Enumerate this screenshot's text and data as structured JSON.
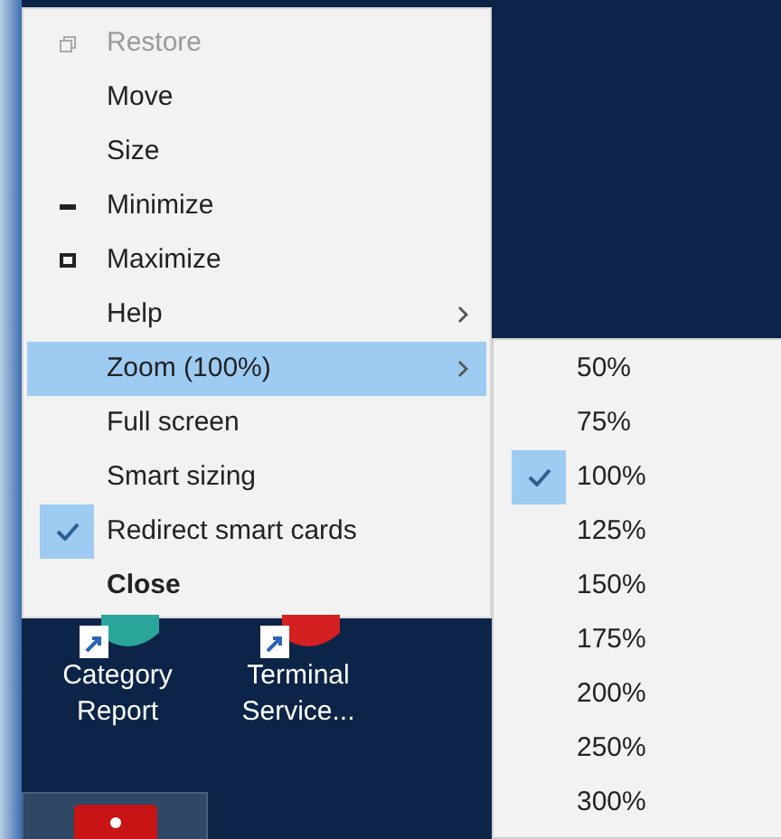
{
  "system_menu": {
    "items": [
      {
        "label": "Restore",
        "kind": "restore",
        "disabled": true,
        "selected": false,
        "checked": false,
        "submenu": false,
        "default": false
      },
      {
        "label": "Move",
        "kind": "plain",
        "disabled": false,
        "selected": false,
        "checked": false,
        "submenu": false,
        "default": false
      },
      {
        "label": "Size",
        "kind": "plain",
        "disabled": false,
        "selected": false,
        "checked": false,
        "submenu": false,
        "default": false
      },
      {
        "label": "Minimize",
        "kind": "minimize",
        "disabled": false,
        "selected": false,
        "checked": false,
        "submenu": false,
        "default": false
      },
      {
        "label": "Maximize",
        "kind": "maximize",
        "disabled": false,
        "selected": false,
        "checked": false,
        "submenu": false,
        "default": false
      },
      {
        "label": "Help",
        "kind": "plain",
        "disabled": false,
        "selected": false,
        "checked": false,
        "submenu": true,
        "default": false
      },
      {
        "label": "Zoom (100%)",
        "kind": "plain",
        "disabled": false,
        "selected": true,
        "checked": false,
        "submenu": true,
        "default": false
      },
      {
        "label": "Full screen",
        "kind": "plain",
        "disabled": false,
        "selected": false,
        "checked": false,
        "submenu": false,
        "default": false
      },
      {
        "label": "Smart sizing",
        "kind": "plain",
        "disabled": false,
        "selected": false,
        "checked": false,
        "submenu": false,
        "default": false
      },
      {
        "label": "Redirect smart cards",
        "kind": "plain",
        "disabled": false,
        "selected": false,
        "checked": true,
        "submenu": false,
        "default": false
      },
      {
        "label": "Close",
        "kind": "plain",
        "disabled": false,
        "selected": false,
        "checked": false,
        "submenu": false,
        "default": true
      }
    ]
  },
  "zoom_submenu": {
    "items": [
      {
        "label": "50%",
        "checked": false
      },
      {
        "label": "75%",
        "checked": false
      },
      {
        "label": "100%",
        "checked": true
      },
      {
        "label": "125%",
        "checked": false
      },
      {
        "label": "150%",
        "checked": false
      },
      {
        "label": "175%",
        "checked": false
      },
      {
        "label": "200%",
        "checked": false
      },
      {
        "label": "250%",
        "checked": false
      },
      {
        "label": "300%",
        "checked": false
      }
    ]
  },
  "desktop_icons": [
    {
      "label": "Category Report",
      "color": "#2aa59a"
    },
    {
      "label": "Terminal Service...",
      "color": "#d42020"
    }
  ]
}
